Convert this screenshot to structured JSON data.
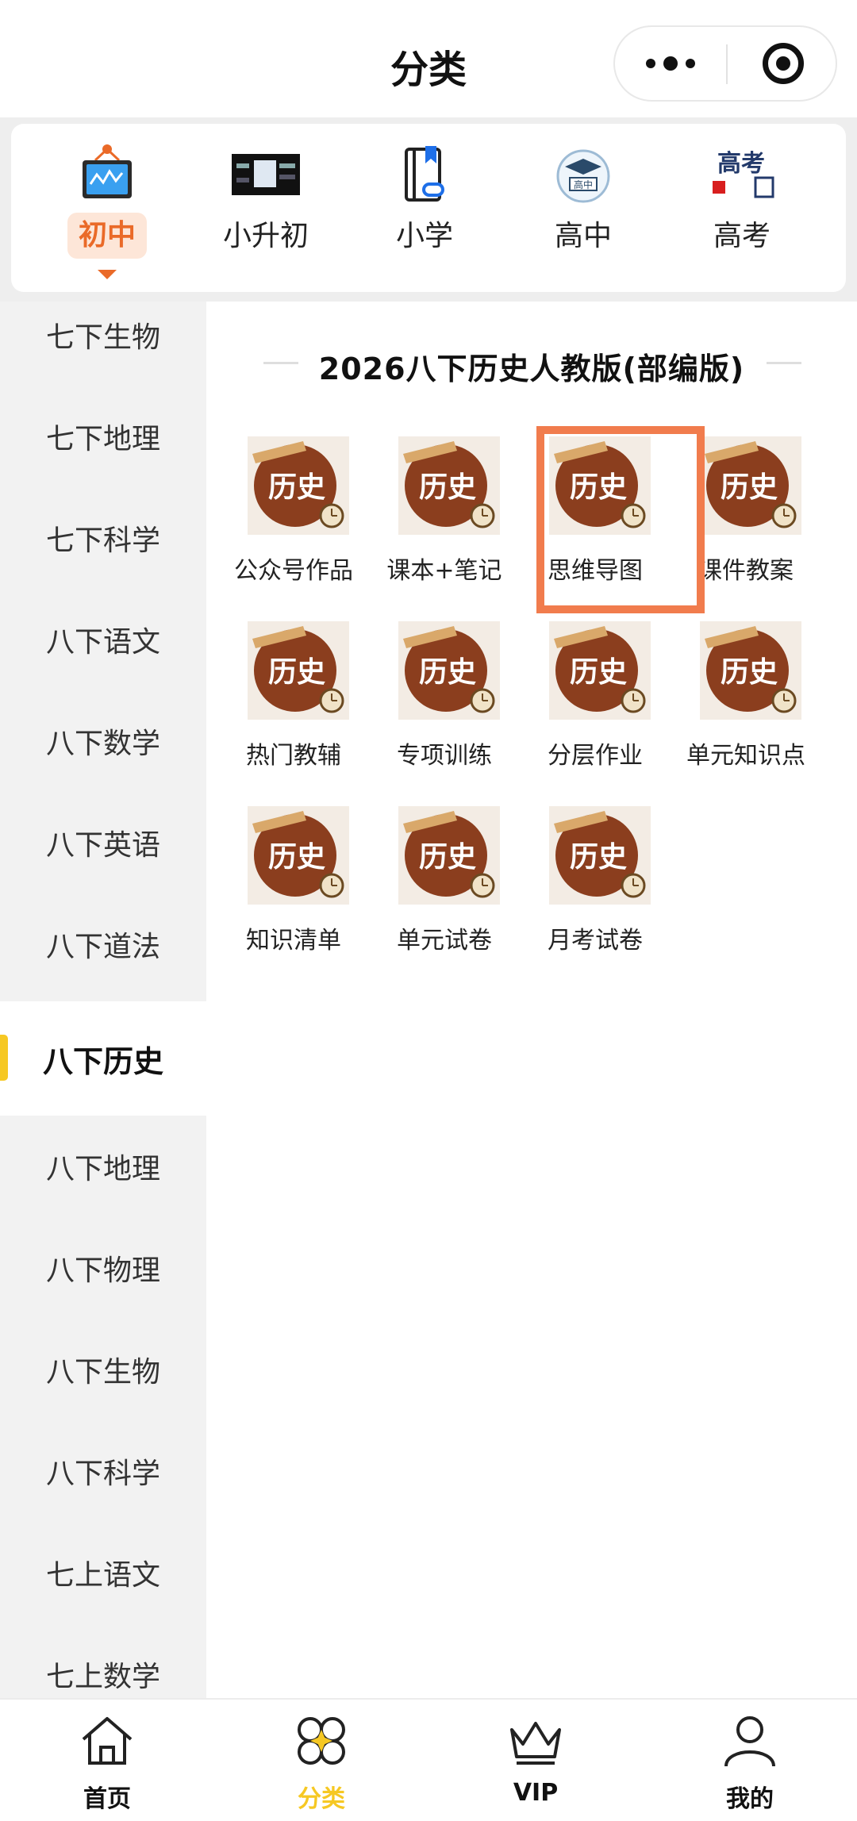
{
  "header": {
    "title": "分类",
    "more_icon": "more-dots-icon",
    "target_icon": "record-target-icon"
  },
  "levels": [
    {
      "label": "初中",
      "icon": "monitor-chart-icon",
      "active": true
    },
    {
      "label": "小升初",
      "icon": "promo-banner-image",
      "active": false
    },
    {
      "label": "小学",
      "icon": "book-link-icon",
      "active": false
    },
    {
      "label": "高中",
      "icon": "graduation-cap-icon",
      "active": false
    },
    {
      "label": "高考",
      "icon": "gaokao-text-icon",
      "icon_text": "高考",
      "active": false
    }
  ],
  "sidebar": {
    "items": [
      "七下生物",
      "七下地理",
      "七下科学",
      "八下语文",
      "八下数学",
      "八下英语",
      "八下道法",
      "八下历史",
      "八下地理",
      "八下物理",
      "八下生物",
      "八下科学",
      "七上语文",
      "七上数学"
    ],
    "active_index": 7
  },
  "content": {
    "section_title": "2026八下历史人教版(部编版)",
    "icon_text": "历史",
    "items": [
      "公众号作品",
      "课本+笔记",
      "思维导图",
      "课件教案",
      "热门教辅",
      "专项训练",
      "分层作业",
      "单元知识点",
      "知识清单",
      "单元试卷",
      "月考试卷"
    ],
    "highlighted_index": 2
  },
  "tabbar": {
    "items": [
      {
        "label": "首页",
        "icon": "home-icon"
      },
      {
        "label": "分类",
        "icon": "category-icon"
      },
      {
        "label": "VIP",
        "icon": "crown-icon"
      },
      {
        "label": "我的",
        "icon": "user-icon"
      }
    ],
    "active_index": 1
  },
  "colors": {
    "accent_orange": "#ea6a28",
    "accent_yellow": "#f6c823",
    "highlight_box": "#f17c4d",
    "history_icon_brown": "#8b3e1e"
  }
}
